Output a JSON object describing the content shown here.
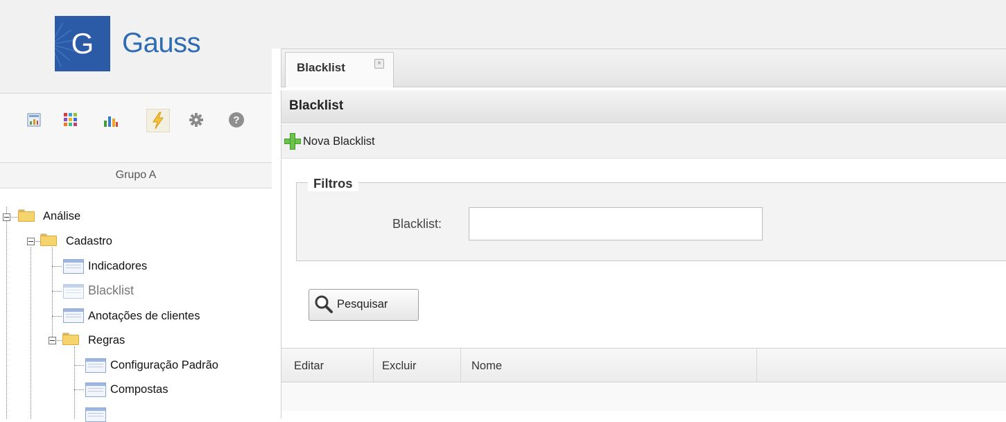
{
  "app": {
    "logo_letter": "G",
    "logo_text": "Gauss",
    "brand_color": "#2b5aa6"
  },
  "toolbar": {
    "icons": [
      "dashboard-icon",
      "grid-apps-icon",
      "bar-chart-icon",
      "lightning-icon",
      "gear-icon",
      "help-icon"
    ],
    "active_icon": "lightning-icon"
  },
  "sidebar": {
    "group_label": "Grupo A",
    "tree": {
      "analise": "Análise",
      "cadastro": "Cadastro",
      "indicadores": "Indicadores",
      "blacklist": "Blacklist",
      "anotacoes": "Anotações de clientes",
      "regras": "Regras",
      "configuracao": "Configuração Padrão",
      "compostas": "Compostas"
    }
  },
  "tabs": {
    "active_label": "Blacklist",
    "close_glyph": "×"
  },
  "panel": {
    "title": "Blacklist",
    "new_button_label": "Nova Blacklist"
  },
  "filters": {
    "legend": "Filtros",
    "blacklist_label": "Blacklist:",
    "blacklist_value": "",
    "search_button_label": "Pesquisar"
  },
  "grid": {
    "columns": [
      "Editar",
      "Excluir",
      "Nome"
    ]
  }
}
